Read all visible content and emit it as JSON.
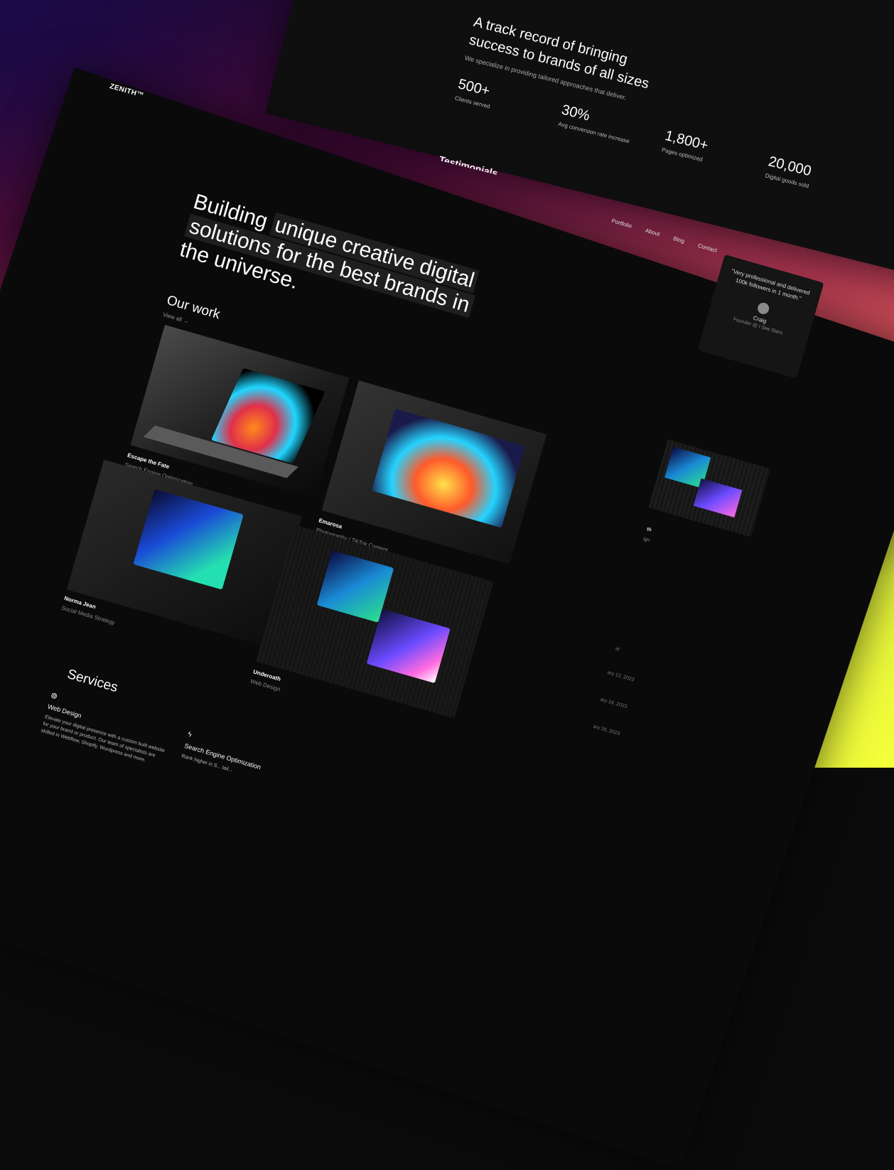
{
  "brand": {
    "logo": "ZENITH™"
  },
  "nav": {
    "items": [
      "Portfolio",
      "About",
      "Blog",
      "Contact"
    ]
  },
  "hero": {
    "line1_a": "Building ",
    "line1_b": "unique creative digital",
    "line2": "solutions for the best brands in",
    "line3": "the universe."
  },
  "work": {
    "title": "Our work",
    "view_all": "View all →",
    "projects": [
      {
        "title": "Escape the Fate",
        "subtitle": "Search Engine Optimization"
      },
      {
        "title": "Emarosa",
        "subtitle": "Photography / TikTok Content"
      },
      {
        "title": "Norma Jean",
        "subtitle": "Social Media Strategy"
      },
      {
        "title": "Underoath",
        "subtitle": "Web Design"
      },
      {
        "title": "th",
        "subtitle": "ign"
      }
    ]
  },
  "stats": {
    "title": "A track record of bringing success to brands of all sizes",
    "subtitle": "We specialize in providing tailored approaches that deliver.",
    "items": [
      {
        "value": "500+",
        "label": "Clients served"
      },
      {
        "value": "30%",
        "label": "Avg conversion rate increase"
      },
      {
        "value": "1,800+",
        "label": "Pages optimized"
      },
      {
        "value": "20,000",
        "label": "Digital goods sold"
      }
    ]
  },
  "testimonials": {
    "heading_peek": "Testimonials",
    "quote": "\"Very professional and delivered 100k followers in 1 month.\"",
    "name": "Craig",
    "role": "Founder @ I See Stars"
  },
  "services": {
    "title": "Services",
    "items": [
      {
        "icon": "globe-icon",
        "title": "Web Design",
        "desc": "Elevate your digital presence with a custom built website for your brand or product. Our team of specialists are skilled in Webflow, Shopify, Wordpress and more."
      },
      {
        "icon": "lightning-icon",
        "title": "Search Engine Optimization",
        "desc": "Rank higher in S... tail..."
      }
    ]
  },
  "blog": {
    "dates": [
      "id",
      "ary 12, 2023",
      "ary 19, 2023",
      "ary 26, 2023"
    ]
  },
  "colors": {
    "bg": "#0a0a0a",
    "accent_top": "#1c0a4a",
    "accent_bottom": "#e2f23a"
  }
}
